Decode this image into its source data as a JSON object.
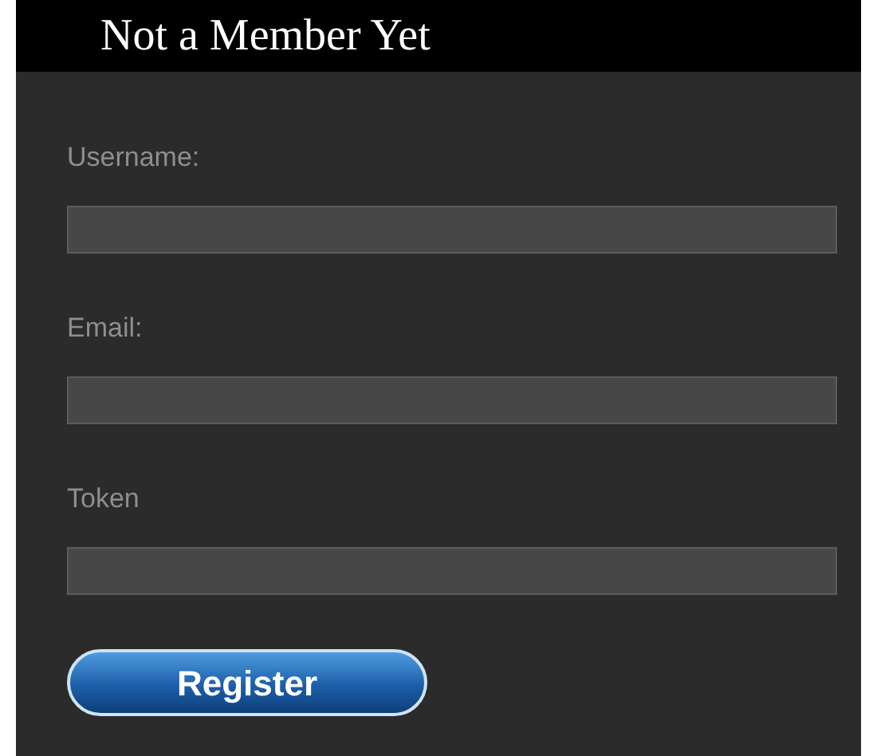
{
  "header": {
    "title": "Not a Member Yet"
  },
  "fields": [
    {
      "label": "Username:"
    },
    {
      "label": "Email:"
    },
    {
      "label": "Token"
    }
  ],
  "button": {
    "label": "Register"
  }
}
